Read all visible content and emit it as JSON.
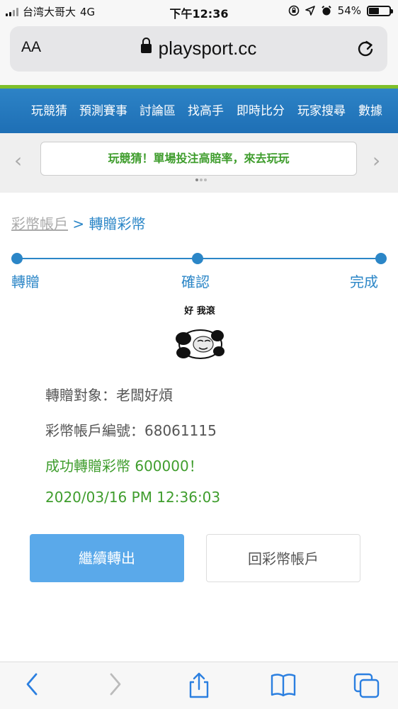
{
  "status": {
    "carrier": "台湾大哥大",
    "network": "4G",
    "time": "下午12:36",
    "battery": "54%",
    "battery_level": 0.54
  },
  "browser": {
    "text_size_label": "AA",
    "url": "playsport.cc"
  },
  "nav": {
    "items": [
      "玩競猜",
      "預測賽事",
      "討論區",
      "找高手",
      "即時比分",
      "玩家搜尋",
      "數據"
    ]
  },
  "promo": {
    "text": "玩競猜！單場投注高賠率，來去玩玩",
    "prev": "‹",
    "next": "›"
  },
  "breadcrumb": {
    "home": "彩幣帳戶",
    "separator": ">",
    "current": "轉贈彩幣"
  },
  "steps": [
    "轉贈",
    "確認",
    "完成"
  ],
  "meme": {
    "caption": "好 我滾"
  },
  "details": {
    "recipient": "轉贈對象：老闆好煩",
    "account": "彩幣帳戶編號：68061115",
    "success": "成功轉贈彩幣 600000！",
    "timestamp": "2020/03/16 PM 12:36:03"
  },
  "buttons": {
    "continue": "繼續轉出",
    "back": "回彩幣帳戶"
  },
  "colors": {
    "accent": "#2b86c7",
    "success": "#3f9d2d",
    "button": "#5aa9ea",
    "nav": "#1e6fb5"
  }
}
